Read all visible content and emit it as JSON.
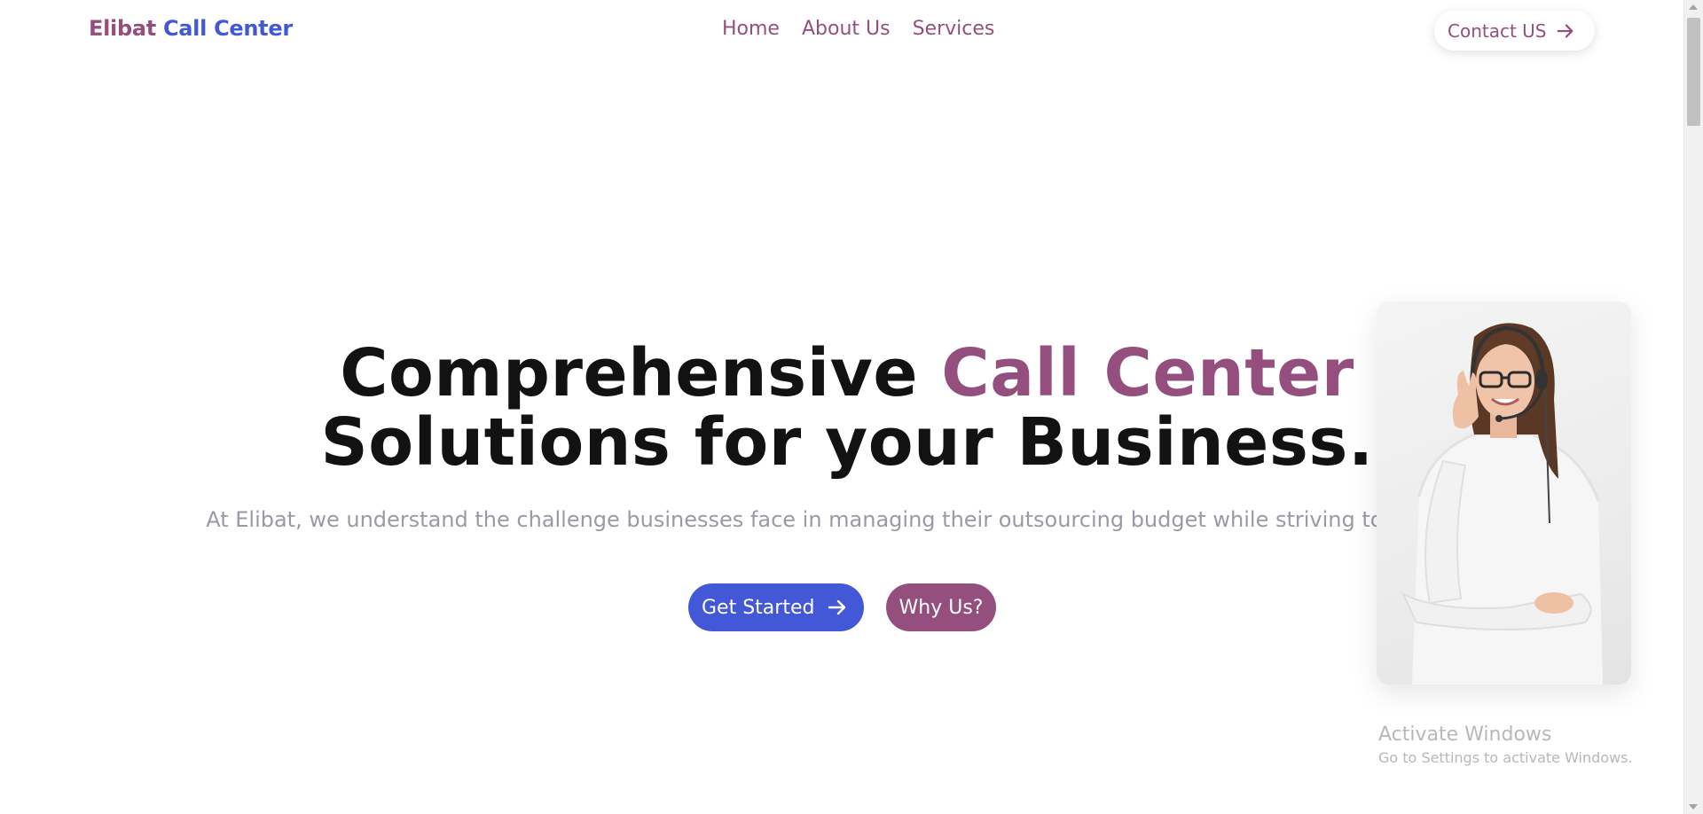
{
  "header": {
    "brand_part1": "Elibat",
    "brand_part2": "Call Center",
    "nav": [
      {
        "label": "Home"
      },
      {
        "label": "About Us"
      },
      {
        "label": "Services"
      }
    ],
    "contact_label": "Contact US",
    "contact_icon": "arrow-right-icon"
  },
  "hero": {
    "title_part1": "Comprehensive ",
    "title_accent": "Call Center",
    "title_line2": "Solutions for your Business.",
    "subtitle": "At Elibat, we understand the challenge businesses face in managing their outsourcing budget while striving to enhance.",
    "primary_button": "Get Started",
    "primary_icon": "arrow-right-icon",
    "secondary_button": "Why Us?",
    "image_subject": "call center agent with headset"
  },
  "watermark": {
    "title": "Activate Windows",
    "subtitle": "Go to Settings to activate Windows."
  },
  "colors": {
    "brand_purple": "#954f7f",
    "brand_blue": "#4258d6",
    "heading": "#121212",
    "muted_text": "#9a9aa6"
  }
}
